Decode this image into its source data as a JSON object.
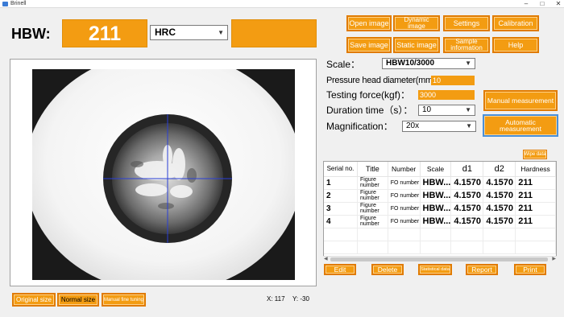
{
  "window": {
    "title": "Brinell"
  },
  "hbw": {
    "label": "HBW:",
    "value": "211",
    "unit": "HRC"
  },
  "toolbar": {
    "open_image": "Open image",
    "dynamic_image": "Dynamic image",
    "settings": "Settings",
    "calibration": "Calibration",
    "save_image": "Save image",
    "static_image": "Static image",
    "sample_information": "Sample information",
    "help": "Help"
  },
  "form": {
    "scale_label": "Scale：",
    "scale_value": "HBW10/3000",
    "diameter_label": "Pressure head diameter(mm)：",
    "diameter_value": "10",
    "force_label": "Testing force(kgf)：",
    "force_value": "3000",
    "duration_label": "Duration time（s）：",
    "duration_value": "10",
    "magnification_label": "Magnification：",
    "magnification_value": "20x"
  },
  "actions": {
    "manual_measurement": "Manual measurement",
    "automatic_measurement": "Automatic measurement",
    "wipe_data": "Wipe data"
  },
  "table": {
    "headers": [
      "Serial no.",
      "Title",
      "Number",
      "Scale",
      "d1",
      "d2",
      "Hardness"
    ],
    "rows": [
      {
        "serial": "1",
        "title": "Figure number",
        "number": "FO number",
        "scale": "HBW...",
        "d1": "4.1570",
        "d2": "4.1570",
        "hardness": "211"
      },
      {
        "serial": "2",
        "title": "Figure number",
        "number": "FO number",
        "scale": "HBW...",
        "d1": "4.1570",
        "d2": "4.1570",
        "hardness": "211"
      },
      {
        "serial": "3",
        "title": "Figure number",
        "number": "FO number",
        "scale": "HBW...",
        "d1": "4.1570",
        "d2": "4.1570",
        "hardness": "211"
      },
      {
        "serial": "4",
        "title": "Figure number",
        "number": "FO number",
        "scale": "HBW...",
        "d1": "4.1570",
        "d2": "4.1570",
        "hardness": "211"
      }
    ]
  },
  "bottom_actions": {
    "edit": "Edit",
    "delete": "Delete",
    "statistical_data": "Statistical data",
    "report": "Report",
    "print": "Print"
  },
  "view_controls": {
    "original_size": "Original size",
    "normal_size": "Normal size",
    "manual_fine_tuning": "Manual fine tuning"
  },
  "coords": {
    "x": "X: 117",
    "y": "Y: -30"
  },
  "colors": {
    "accent": "#f39c12",
    "accent_border": "#e07b00",
    "crosshair": "#2a3fd6"
  }
}
